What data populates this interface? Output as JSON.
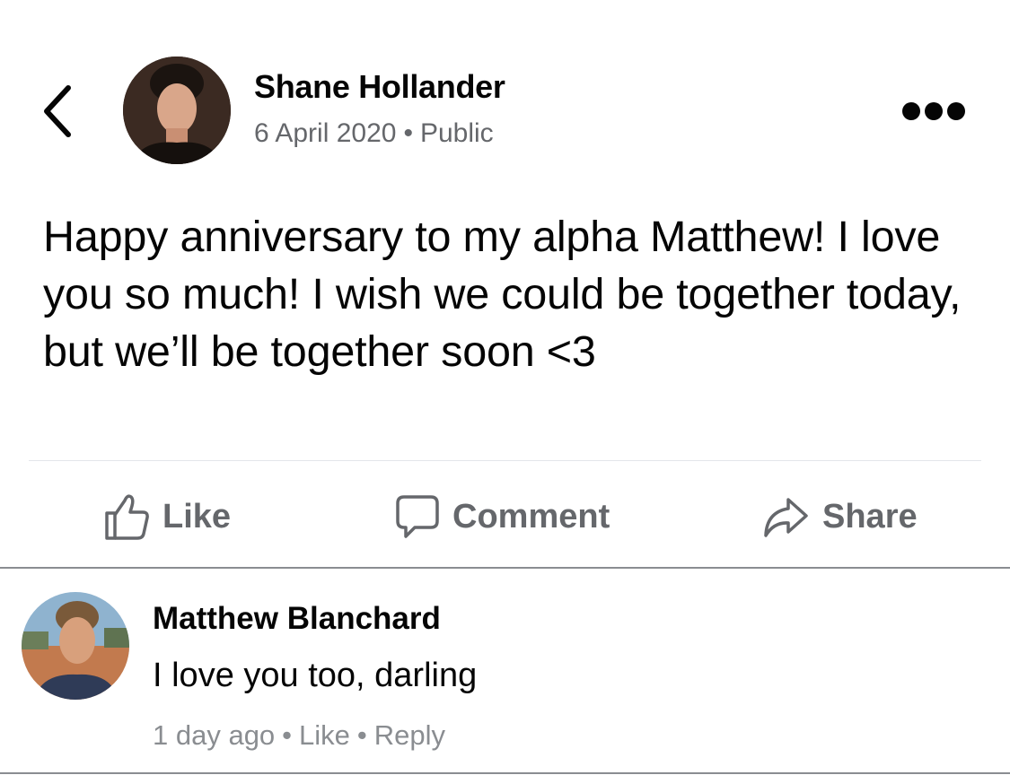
{
  "post": {
    "author": "Shane Hollander",
    "date": "6 April 2020",
    "separator": "•",
    "audience": "Public",
    "text": "Happy anniversary to my alpha Matthew! I love you so much! I wish we could be together today, but we’ll be together soon <3"
  },
  "actions": {
    "like": "Like",
    "comment": "Comment",
    "share": "Share"
  },
  "comment": {
    "author": "Matthew Blanchard",
    "text": "I love you too, darling",
    "time": "1 day ago",
    "like": "Like",
    "reply": "Reply"
  },
  "icons": {
    "back": "chevron-left-icon",
    "more": "more-horizontal-icon",
    "like": "thumbs-up-icon",
    "comment": "comment-bubble-icon",
    "share": "share-arrow-icon"
  },
  "colors": {
    "text_primary": "#050505",
    "text_secondary": "#65676b",
    "muted": "#8a8d91"
  }
}
